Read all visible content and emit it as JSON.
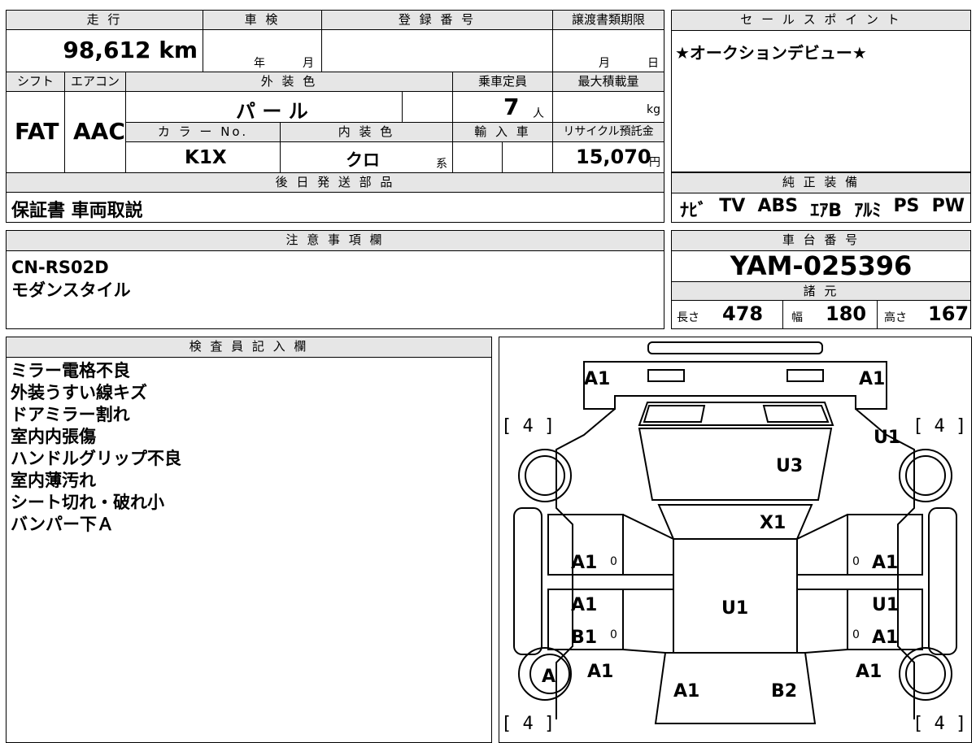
{
  "top": {
    "h_mileage": "走 行",
    "h_inspection": "車 検",
    "h_registration": "登 録 番 号",
    "h_transfer": "譲渡書類期限",
    "mileage": "98,612 km",
    "insp_year": "年",
    "insp_month": "月",
    "transfer_month": "月",
    "transfer_day": "日",
    "h_shift": "シフト",
    "h_ac": "エアコン",
    "h_exterior": "外 装 色",
    "h_capacity": "乗車定員",
    "h_load": "最大積載量",
    "shift": "FAT",
    "ac": "AAC",
    "exterior": "パ ー ル",
    "capacity": "7",
    "capacity_unit": "人",
    "load_unit": "kg",
    "h_color_no": "カ ラ ー No.",
    "h_interior": "内 装 色",
    "h_import": "輸 入 車",
    "h_recycle": "リサイクル預託金",
    "color_no": "K1X",
    "interior": "クロ",
    "interior_suffix": "系",
    "recycle": "15,070",
    "recycle_unit": "円",
    "h_parts": "後 日 発 送 部 品",
    "parts": "保証書 車両取説"
  },
  "sales": {
    "header": "セ ー ル ス ポ イ ン ト",
    "text": "★オークションデビュー★"
  },
  "equipment": {
    "header": "純 正 装 備",
    "items": [
      "ﾅﾋﾞ",
      "TV",
      "ABS",
      "ｴｱB",
      "ｱﾙﾐ",
      "PS",
      "PW"
    ]
  },
  "notes": {
    "header": "注 意 事 項 欄",
    "lines": [
      "CN-RS02D",
      "モダンスタイル"
    ]
  },
  "chassis": {
    "header": "車 台 番 号",
    "number": "YAM-025396",
    "spec_header": "諸 元",
    "length_label": "長さ",
    "length": "478",
    "width_label": "幅",
    "width": "180",
    "height_label": "高さ",
    "height": "167"
  },
  "inspector": {
    "header": "検 査 員 記 入 欄",
    "lines": [
      "ミラー電格不良",
      "外装うすい線キズ",
      "ドアミラー割れ",
      "室内内張傷",
      "ハンドルグリップ不良",
      "室内薄汚れ",
      "シート切れ・破れ小",
      "バンパー下Ａ"
    ]
  },
  "diagram": {
    "marks": [
      "A1",
      "A1",
      "U1",
      "U3",
      "X1",
      "A1",
      "A1",
      "A1",
      "U1",
      "U1",
      "B1",
      "A1",
      "A",
      "A1",
      "A1",
      "A1",
      "B2"
    ],
    "tires": [
      "[ 4 ]",
      "[ 4 ]",
      "[ 4 ]",
      "[ 4 ]"
    ],
    "flags": [
      "0",
      "0",
      "0",
      "0"
    ]
  }
}
